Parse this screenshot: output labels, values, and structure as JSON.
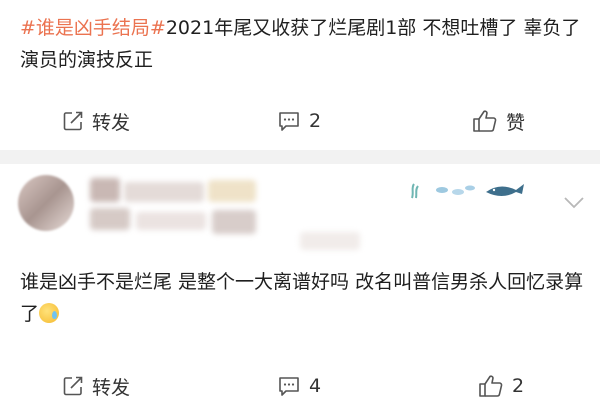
{
  "post": {
    "hashtag": "#谁是凶手结局#",
    "text": "2021年尾又收获了烂尾剧1部 不想吐槽了 辜负了演员的演技反正",
    "actions": {
      "repost_label": "转发",
      "comment_count": "2",
      "like_label": "赞"
    }
  },
  "comment": {
    "text": "谁是凶手不是烂尾 是整个一大离谱好吗 改名叫普信男杀人回忆录算了",
    "actions": {
      "repost_label": "转发",
      "comment_count": "4",
      "like_count": "2"
    }
  },
  "colors": {
    "hashtag": "#eb7350",
    "icon": "#555555",
    "divider": "#f2f2f2"
  }
}
